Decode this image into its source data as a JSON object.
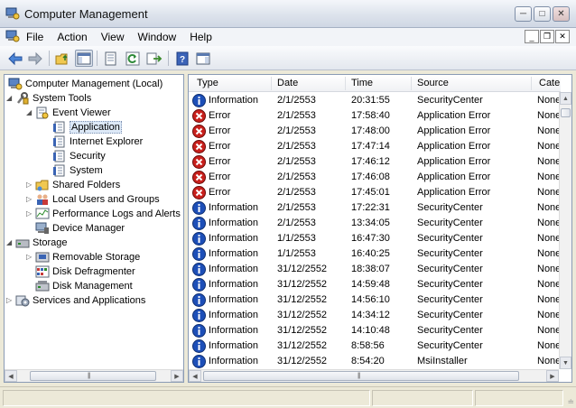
{
  "window": {
    "title": "Computer Management"
  },
  "menu": {
    "items": [
      "File",
      "Action",
      "View",
      "Window",
      "Help"
    ]
  },
  "toolbar": {
    "buttons": [
      "back-icon",
      "forward-icon",
      "up-folder-icon",
      "show-hide-tree-icon",
      "properties-icon",
      "refresh-icon",
      "export-list-icon",
      "help-icon",
      "show-hide-action-pane-icon"
    ]
  },
  "tree": [
    {
      "label": "Computer Management (Local)",
      "icon": "computer-management-icon",
      "level": 0,
      "twisty": ""
    },
    {
      "label": "System Tools",
      "icon": "system-tools-icon",
      "level": 1,
      "twisty": "expanded"
    },
    {
      "label": "Event Viewer",
      "icon": "event-viewer-icon",
      "level": 2,
      "twisty": "expanded"
    },
    {
      "label": "Application",
      "icon": "log-icon",
      "level": 3,
      "twisty": "",
      "selected": true
    },
    {
      "label": "Internet Explorer",
      "icon": "log-icon",
      "level": 3,
      "twisty": ""
    },
    {
      "label": "Security",
      "icon": "log-icon",
      "level": 3,
      "twisty": ""
    },
    {
      "label": "System",
      "icon": "log-icon",
      "level": 3,
      "twisty": ""
    },
    {
      "label": "Shared Folders",
      "icon": "shared-folders-icon",
      "level": 2,
      "twisty": "collapsed"
    },
    {
      "label": "Local Users and Groups",
      "icon": "users-groups-icon",
      "level": 2,
      "twisty": "collapsed"
    },
    {
      "label": "Performance Logs and Alerts",
      "icon": "performance-icon",
      "level": 2,
      "twisty": "collapsed"
    },
    {
      "label": "Device Manager",
      "icon": "device-manager-icon",
      "level": 2,
      "twisty": ""
    },
    {
      "label": "Storage",
      "icon": "storage-icon",
      "level": 1,
      "twisty": "expanded"
    },
    {
      "label": "Removable Storage",
      "icon": "removable-storage-icon",
      "level": 2,
      "twisty": "collapsed"
    },
    {
      "label": "Disk Defragmenter",
      "icon": "defragmenter-icon",
      "level": 2,
      "twisty": ""
    },
    {
      "label": "Disk Management",
      "icon": "disk-management-icon",
      "level": 2,
      "twisty": ""
    },
    {
      "label": "Services and Applications",
      "icon": "services-icon",
      "level": 1,
      "twisty": "collapsed"
    }
  ],
  "table": {
    "columns": [
      "Type",
      "Date",
      "Time",
      "Source",
      "Cate"
    ],
    "rows": [
      {
        "type": "Information",
        "date": "2/1/2553",
        "time": "20:31:55",
        "source": "SecurityCenter",
        "category": "None"
      },
      {
        "type": "Error",
        "date": "2/1/2553",
        "time": "17:58:40",
        "source": "Application Error",
        "category": "None"
      },
      {
        "type": "Error",
        "date": "2/1/2553",
        "time": "17:48:00",
        "source": "Application Error",
        "category": "None"
      },
      {
        "type": "Error",
        "date": "2/1/2553",
        "time": "17:47:14",
        "source": "Application Error",
        "category": "None"
      },
      {
        "type": "Error",
        "date": "2/1/2553",
        "time": "17:46:12",
        "source": "Application Error",
        "category": "None"
      },
      {
        "type": "Error",
        "date": "2/1/2553",
        "time": "17:46:08",
        "source": "Application Error",
        "category": "None"
      },
      {
        "type": "Error",
        "date": "2/1/2553",
        "time": "17:45:01",
        "source": "Application Error",
        "category": "None"
      },
      {
        "type": "Information",
        "date": "2/1/2553",
        "time": "17:22:31",
        "source": "SecurityCenter",
        "category": "None"
      },
      {
        "type": "Information",
        "date": "2/1/2553",
        "time": "13:34:05",
        "source": "SecurityCenter",
        "category": "None"
      },
      {
        "type": "Information",
        "date": "1/1/2553",
        "time": "16:47:30",
        "source": "SecurityCenter",
        "category": "None"
      },
      {
        "type": "Information",
        "date": "1/1/2553",
        "time": "16:40:25",
        "source": "SecurityCenter",
        "category": "None"
      },
      {
        "type": "Information",
        "date": "31/12/2552",
        "time": "18:38:07",
        "source": "SecurityCenter",
        "category": "None"
      },
      {
        "type": "Information",
        "date": "31/12/2552",
        "time": "14:59:48",
        "source": "SecurityCenter",
        "category": "None"
      },
      {
        "type": "Information",
        "date": "31/12/2552",
        "time": "14:56:10",
        "source": "SecurityCenter",
        "category": "None"
      },
      {
        "type": "Information",
        "date": "31/12/2552",
        "time": "14:34:12",
        "source": "SecurityCenter",
        "category": "None"
      },
      {
        "type": "Information",
        "date": "31/12/2552",
        "time": "14:10:48",
        "source": "SecurityCenter",
        "category": "None"
      },
      {
        "type": "Information",
        "date": "31/12/2552",
        "time": "8:58:56",
        "source": "SecurityCenter",
        "category": "None"
      },
      {
        "type": "Information",
        "date": "31/12/2552",
        "time": "8:54:20",
        "source": "MsiInstaller",
        "category": "None"
      }
    ]
  },
  "colors": {
    "info": "#1d4fb8",
    "error": "#c8201c",
    "accent": "#3a6fc4"
  }
}
